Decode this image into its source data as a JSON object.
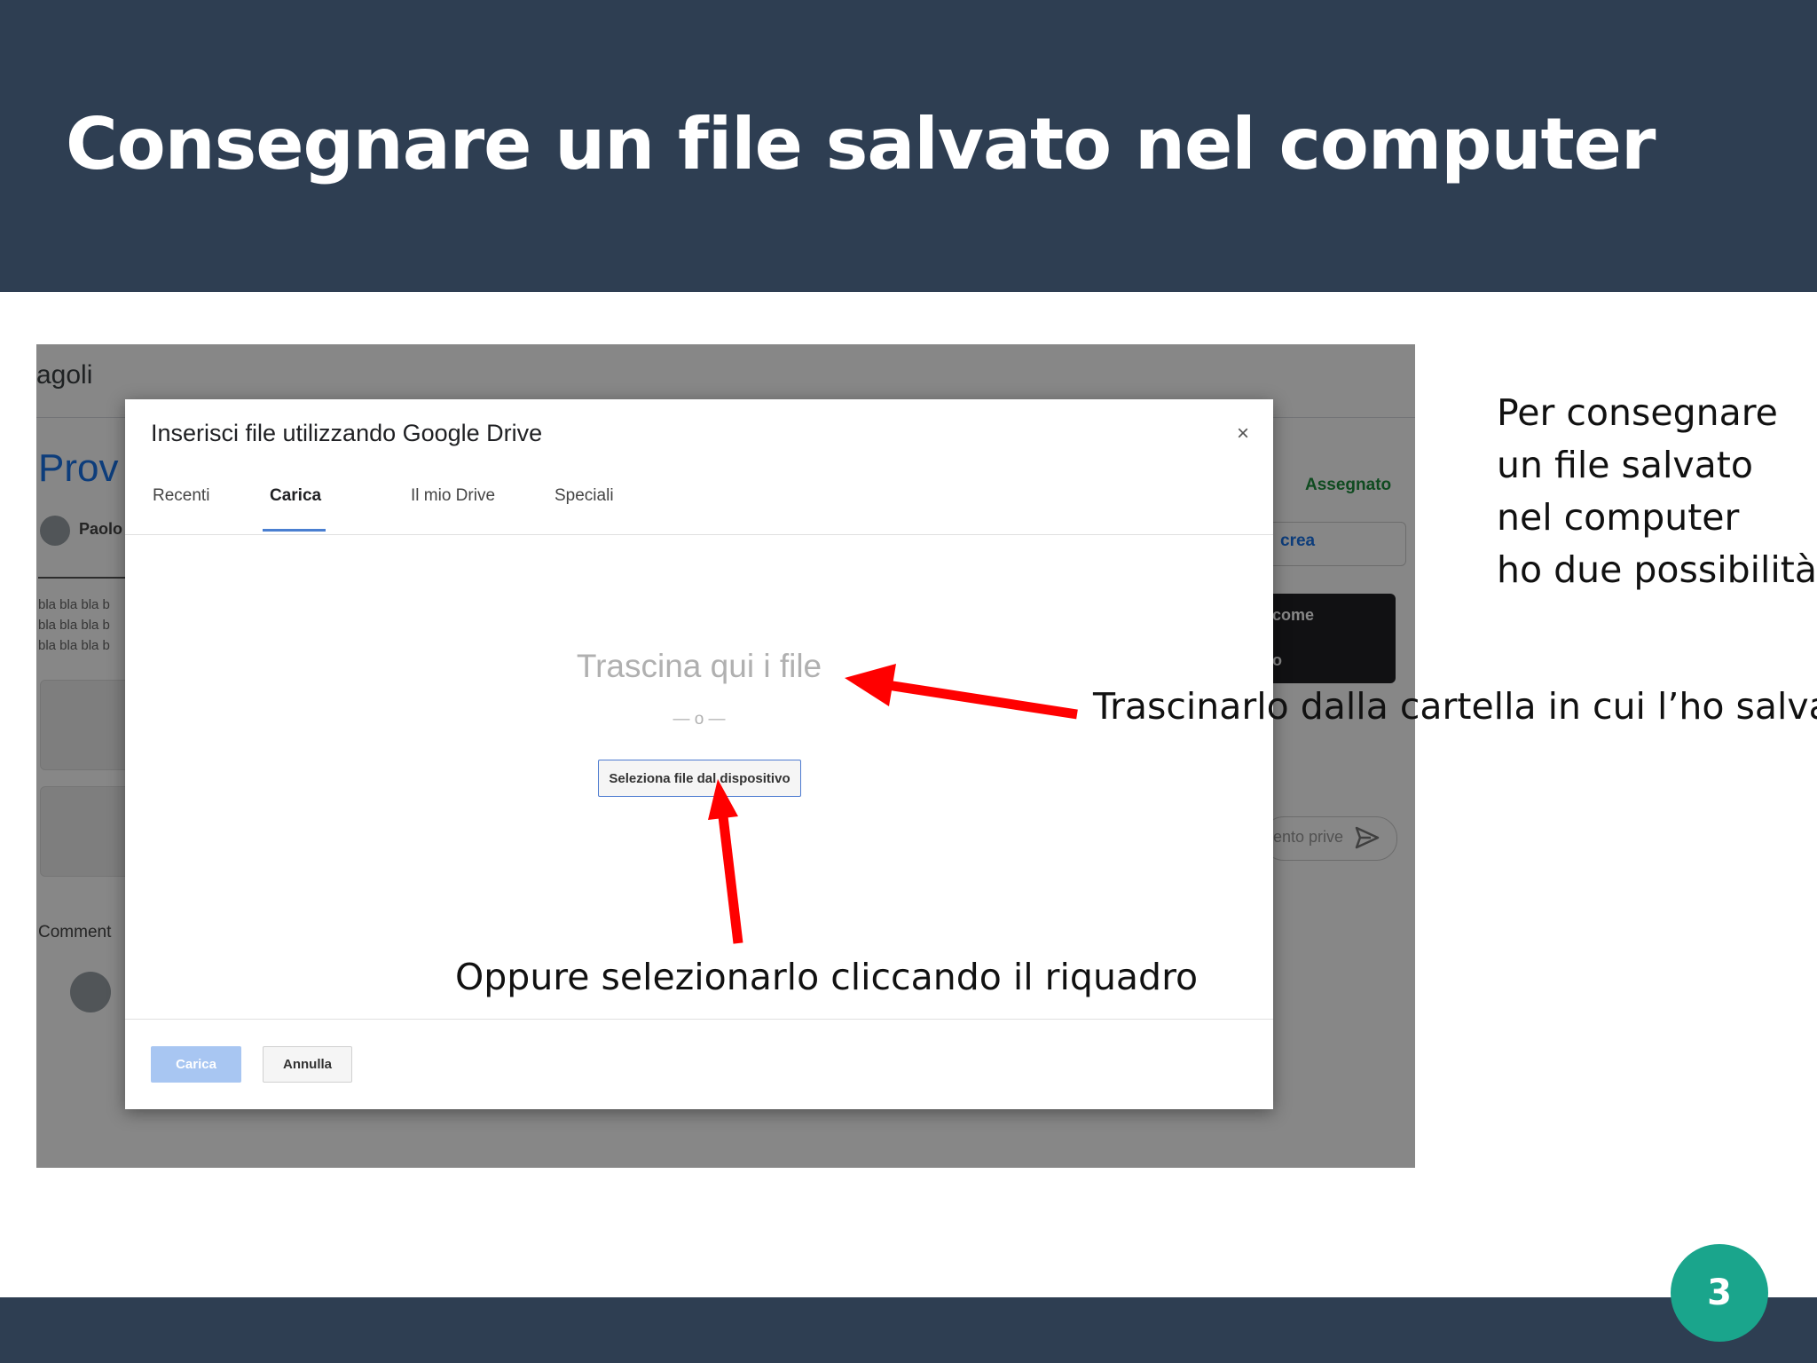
{
  "slide": {
    "title": "Consegnare un file salvato nel computer",
    "page_number": "3",
    "side_text": [
      "Per consegnare",
      " un file salvato",
      "nel computer",
      "ho due possibilità:"
    ],
    "annotation_drag": "Trascinarlo dalla cartella in cui l’ho salvato",
    "annotation_select": "Oppure selezionarlo cliccando  il riquadro"
  },
  "background": {
    "title_fragment": "agoli",
    "heading_fragment": "Prov",
    "author_fragment": "Paolo",
    "body_lines": [
      "bla bla bla b",
      "bla bla bla b",
      "bla bla bla b"
    ],
    "comments_fragment": "Comment",
    "status": "Assegnato",
    "create_fragment": "crea",
    "dark_line1": "come",
    "dark_line2": "o",
    "private_fragment": "ento prive"
  },
  "dialog": {
    "title": "Inserisci file utilizzando Google Drive",
    "close_symbol": "×",
    "tabs": [
      "Recenti",
      "Carica",
      "Il mio Drive",
      "Speciali"
    ],
    "active_tab": "Carica",
    "drop_text": "Trascina qui i file",
    "or_text": "— o —",
    "select_button": "Seleziona file dal dispositivo",
    "upload_button": "Carica",
    "cancel_button": "Annulla"
  },
  "colors": {
    "header_bg": "#2e3e52",
    "badge": "#1aa58c",
    "arrow": "#ff0000",
    "tab_accent": "#4a7fd1",
    "upload_disabled": "#a8c6f2"
  }
}
